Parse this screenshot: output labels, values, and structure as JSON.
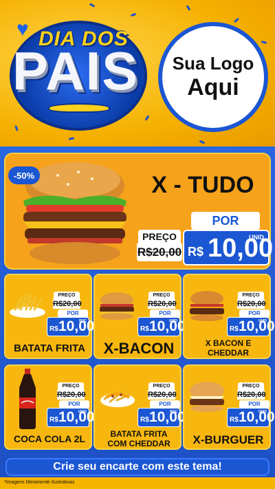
{
  "header": {
    "title_small": "DIA DOS",
    "title_big": "PAIS",
    "logo_line1": "Sua Logo",
    "logo_line2": "Aqui"
  },
  "hero": {
    "discount": "-50%",
    "name": "X - TUDO",
    "preco_label": "PREÇO",
    "old_price": "R$20,00",
    "por_label": "POR",
    "currency": "R$",
    "price": "10,00",
    "unit": "UNID"
  },
  "cards": [
    {
      "name": "BATATA FRITA",
      "preco_label": "PREÇO",
      "old_price": "R$20,00",
      "por_label": "POR",
      "currency": "R$",
      "price": "10,00",
      "unit": "POÇ"
    },
    {
      "name": "X-BACON",
      "preco_label": "PREÇO",
      "old_price": "R$20,00",
      "por_label": "POR",
      "currency": "R$",
      "price": "10,00",
      "unit": "UNID"
    },
    {
      "name_line1": "X BACON E",
      "name_line2": "CHEDDAR",
      "preco_label": "PREÇO",
      "old_price": "R$20,00",
      "por_label": "POR",
      "currency": "R$",
      "price": "10,00",
      "unit": "UNID"
    },
    {
      "name": "COCA COLA 2L",
      "preco_label": "PREÇO",
      "old_price": "R$20,00",
      "por_label": "POR",
      "currency": "R$",
      "price": "10,00",
      "unit": "UNID"
    },
    {
      "name_line1": "BATATA FRITA",
      "name_line2": "COM CHEDDAR",
      "preco_label": "PREÇO",
      "old_price": "R$20,00",
      "por_label": "POR",
      "currency": "R$",
      "price": "10,00",
      "unit": "POÇ"
    },
    {
      "name": "X-BURGUER",
      "preco_label": "PREÇO",
      "old_price": "R$20,00",
      "por_label": "POR",
      "currency": "R$",
      "price": "10,00",
      "unit": "UNID"
    }
  ],
  "cta": "Crie seu encarte com este tema!",
  "disclaimer": "*Imagens Meramente Ilustrativas",
  "colors": {
    "accent_blue": "#1b56d3",
    "accent_yellow": "#f8b70f",
    "hero_orange": "#f6a21b"
  }
}
